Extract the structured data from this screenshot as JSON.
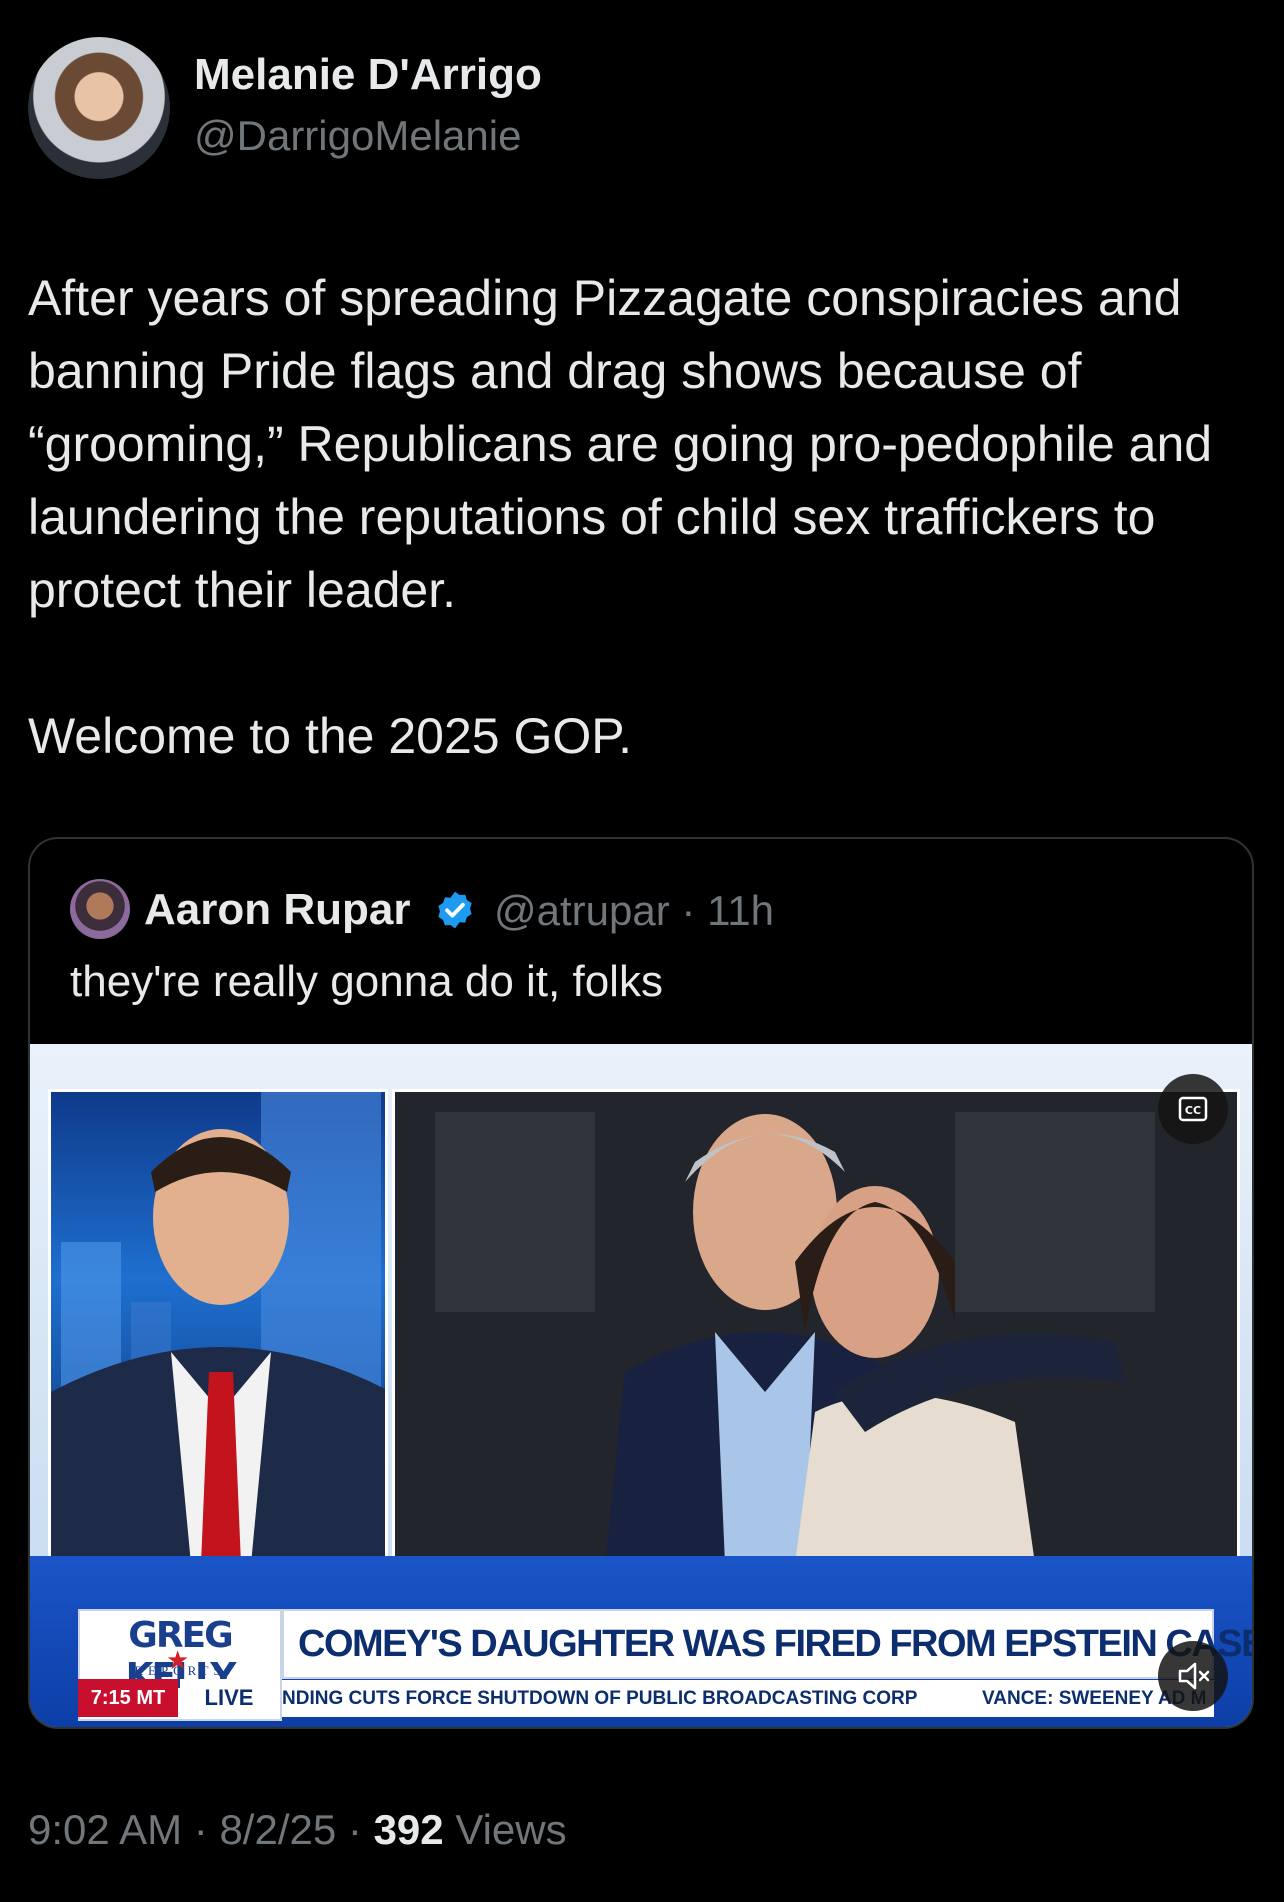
{
  "tweet": {
    "author_name": "Melanie D'Arrigo",
    "author_handle": "@DarrigoMelanie",
    "text": "After years of spreading Pizzagate conspiracies and banning Pride flags and drag shows because of “grooming,” Republicans are going pro-pedophile and laundering the reputations of child sex traffickers to protect their leader.\n\nWelcome to the 2025 GOP.",
    "time": "9:02 AM",
    "date": "8/2/25",
    "views_count": "392",
    "views_label": "Views",
    "separator": "·"
  },
  "quoted_tweet": {
    "author_name": "Aaron Rupar",
    "author_handle": "@atrupar",
    "age": "11h",
    "text": "they're really gonna do it, folks",
    "verified_color": "#1d9bf0"
  },
  "video": {
    "show_logo": "GREG KELLY",
    "show_logo_sub": "REPORTS",
    "time_label": "7:15 MT",
    "live_label": "LIVE",
    "headline": "COMEY'S DAUGHTER WAS FIRED FROM EPSTEIN CASE",
    "ticker_1": "NDING CUTS FORCE SHUTDOWN OF PUBLIC BROADCASTING CORP",
    "ticker_2": "VANCE: SWEENEY AD M",
    "cc_icon": "closed-captions-icon",
    "mute_icon": "muted-speaker-icon"
  },
  "colors": {
    "background": "#000000",
    "text_primary": "#e7e9ea",
    "text_secondary": "#71767b",
    "border": "#2f3336"
  }
}
